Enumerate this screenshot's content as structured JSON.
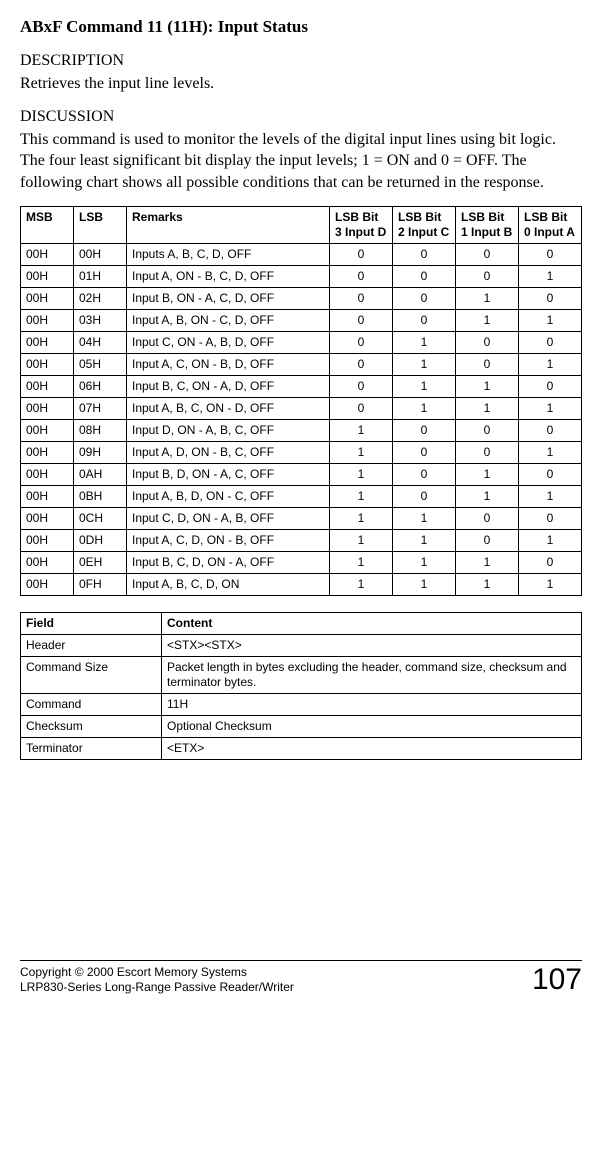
{
  "title": "ABxF Command 11 (11H): Input Status",
  "description": {
    "heading": "DESCRIPTION",
    "body": "Retrieves the input line levels."
  },
  "discussion": {
    "heading": "DISCUSSION",
    "body": "This command is used to monitor the levels of the digital input lines using bit logic.  The four least significant bit display the input levels; 1 = ON and 0 = OFF.  The following chart shows all possible conditions that can be returned in the response."
  },
  "bits_table": {
    "headers": {
      "msb": "MSB",
      "lsb": "LSB",
      "remarks": "Remarks",
      "bit3": "LSB Bit 3 Input D",
      "bit2": "LSB Bit 2 Input C",
      "bit1": "LSB Bit 1 Input B",
      "bit0": "LSB Bit 0 Input A"
    },
    "rows": [
      {
        "msb": "00H",
        "lsb": "00H",
        "remarks": "Inputs A, B, C, D, OFF",
        "b3": "0",
        "b2": "0",
        "b1": "0",
        "b0": "0"
      },
      {
        "msb": "00H",
        "lsb": "01H",
        "remarks": "Input A, ON - B, C, D, OFF",
        "b3": "0",
        "b2": "0",
        "b1": "0",
        "b0": "1"
      },
      {
        "msb": "00H",
        "lsb": "02H",
        "remarks": "Input B, ON - A, C, D, OFF",
        "b3": "0",
        "b2": "0",
        "b1": "1",
        "b0": "0"
      },
      {
        "msb": "00H",
        "lsb": "03H",
        "remarks": "Input A, B, ON - C, D, OFF",
        "b3": "0",
        "b2": "0",
        "b1": "1",
        "b0": "1"
      },
      {
        "msb": "00H",
        "lsb": "04H",
        "remarks": "Input C, ON - A, B, D, OFF",
        "b3": "0",
        "b2": "1",
        "b1": "0",
        "b0": "0"
      },
      {
        "msb": "00H",
        "lsb": "05H",
        "remarks": "Input A, C, ON - B, D, OFF",
        "b3": "0",
        "b2": "1",
        "b1": "0",
        "b0": "1"
      },
      {
        "msb": "00H",
        "lsb": "06H",
        "remarks": "Input B, C, ON - A, D, OFF",
        "b3": "0",
        "b2": "1",
        "b1": "1",
        "b0": "0"
      },
      {
        "msb": "00H",
        "lsb": "07H",
        "remarks": "Input A, B, C, ON - D, OFF",
        "b3": "0",
        "b2": "1",
        "b1": "1",
        "b0": "1"
      },
      {
        "msb": "00H",
        "lsb": "08H",
        "remarks": "Input D, ON - A, B, C, OFF",
        "b3": "1",
        "b2": "0",
        "b1": "0",
        "b0": "0"
      },
      {
        "msb": "00H",
        "lsb": "09H",
        "remarks": "Input A, D, ON - B, C, OFF",
        "b3": "1",
        "b2": "0",
        "b1": "0",
        "b0": "1"
      },
      {
        "msb": "00H",
        "lsb": "0AH",
        "remarks": "Input B, D, ON - A, C, OFF",
        "b3": "1",
        "b2": "0",
        "b1": "1",
        "b0": "0"
      },
      {
        "msb": "00H",
        "lsb": "0BH",
        "remarks": "Input A, B, D, ON - C, OFF",
        "b3": "1",
        "b2": "0",
        "b1": "1",
        "b0": "1"
      },
      {
        "msb": "00H",
        "lsb": "0CH",
        "remarks": "Input C, D, ON - A, B, OFF",
        "b3": "1",
        "b2": "1",
        "b1": "0",
        "b0": "0"
      },
      {
        "msb": "00H",
        "lsb": "0DH",
        "remarks": "Input A, C, D, ON - B, OFF",
        "b3": "1",
        "b2": "1",
        "b1": "0",
        "b0": "1"
      },
      {
        "msb": "00H",
        "lsb": "0EH",
        "remarks": "Input B, C, D, ON - A, OFF",
        "b3": "1",
        "b2": "1",
        "b1": "1",
        "b0": "0"
      },
      {
        "msb": "00H",
        "lsb": "0FH",
        "remarks": "Input A, B, C, D, ON",
        "b3": "1",
        "b2": "1",
        "b1": "1",
        "b0": "1"
      }
    ]
  },
  "packet_table": {
    "headers": {
      "field": "Field",
      "content": "Content"
    },
    "rows": [
      {
        "field": "Header",
        "content": "<STX><STX>"
      },
      {
        "field": "Command Size",
        "content": "Packet length in bytes excluding the header, command size, checksum and terminator bytes."
      },
      {
        "field": "Command",
        "content": "11H"
      },
      {
        "field": "Checksum",
        "content": "Optional Checksum"
      },
      {
        "field": "Terminator",
        "content": "<ETX>"
      }
    ]
  },
  "footer": {
    "line1": "Copyright © 2000 Escort Memory Systems",
    "line2": "LRP830-Series Long-Range Passive Reader/Writer",
    "page": "107"
  }
}
